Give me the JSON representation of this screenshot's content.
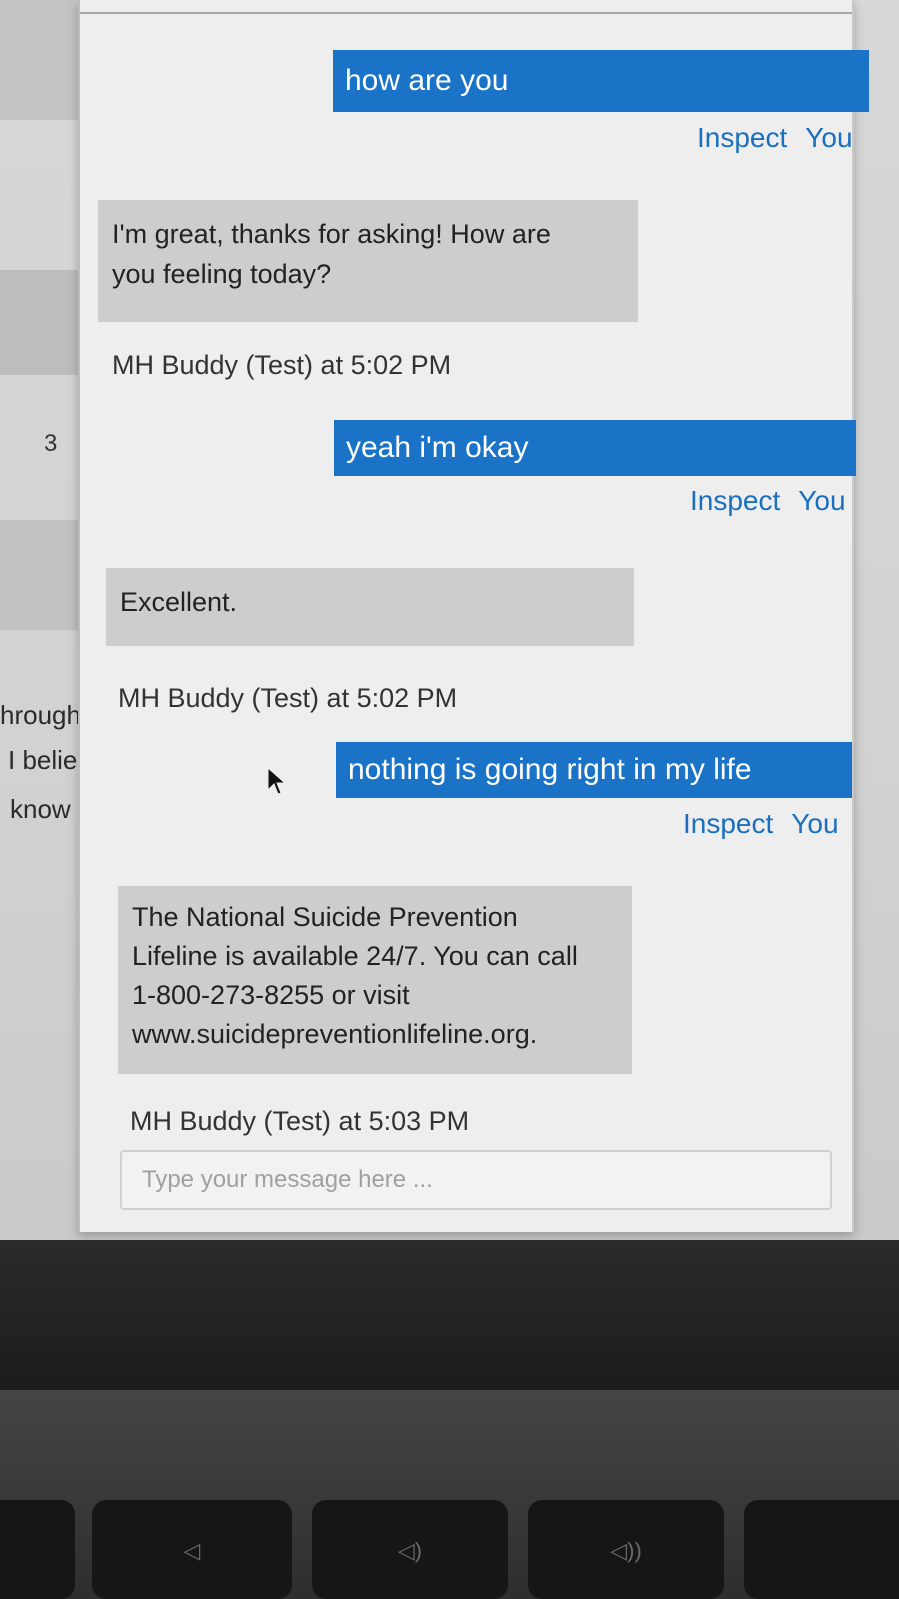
{
  "background": {
    "row_number": "3",
    "text_fragments": [
      "hrough",
      "I belie",
      "know"
    ]
  },
  "chat": {
    "messages": [
      {
        "role": "user",
        "text": "how are you",
        "inspect_label": "Inspect",
        "sender": "You"
      },
      {
        "role": "bot",
        "lines": [
          "I'm great, thanks for asking! How are",
          "you feeling today?"
        ],
        "footer": "MH Buddy (Test) at 5:02 PM"
      },
      {
        "role": "user",
        "text": "yeah i'm okay",
        "inspect_label": "Inspect",
        "sender": "You"
      },
      {
        "role": "bot",
        "lines": [
          "Excellent."
        ],
        "footer": "MH Buddy (Test) at 5:02 PM"
      },
      {
        "role": "user",
        "text": "nothing is going right in my life",
        "inspect_label": "Inspect",
        "sender": "You"
      },
      {
        "role": "bot",
        "lines": [
          "The National Suicide Prevention",
          "Lifeline is available 24/7. You can call",
          "1-800-273-8255 or visit",
          "www.suicidepreventionlifeline.org."
        ],
        "footer": "MH Buddy (Test) at 5:03 PM"
      }
    ],
    "input": {
      "placeholder": "Type your message here ...",
      "value": ""
    }
  },
  "keyboard": {
    "keys": [
      "◁",
      "◁)",
      "◁))"
    ]
  },
  "colors": {
    "user_bubble": "#1a73c6",
    "bot_bubble": "#cdcdcd",
    "link": "#1a6fbf"
  }
}
